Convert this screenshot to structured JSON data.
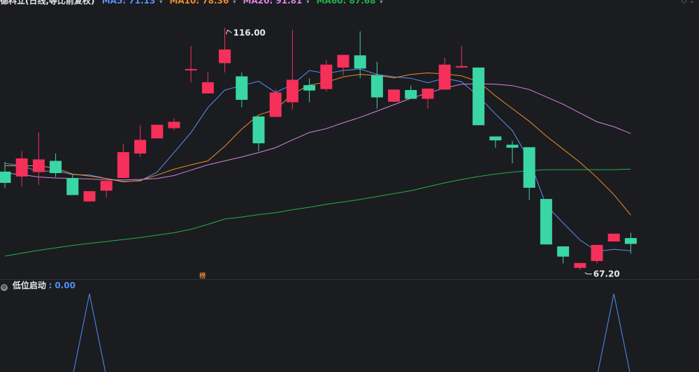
{
  "header": {
    "title": "德科立(日线,等比前复权)",
    "ma_items": [
      {
        "label": "MA5: 71.13",
        "color": "#5b8ff5"
      },
      {
        "label": "MA10: 78.36",
        "color": "#ef8d2b"
      },
      {
        "label": "MA20: 91.81",
        "color": "#d783e0"
      },
      {
        "label": "MA60: 87.68",
        "color": "#22b14c"
      }
    ],
    "arrow_glyph": "▾",
    "menu_icon": "chevron-diamond-icon"
  },
  "colors": {
    "background": "#1b1c20",
    "up": "#f5305a",
    "down": "#3ad6a4",
    "ma5": "#5b8ff5",
    "ma10": "#ef8d2b",
    "ma20": "#d783e0",
    "ma60": "#22b14c",
    "indicator": "#4f8ef7"
  },
  "annotations": {
    "high_label": "116.00",
    "low_label": "67.20",
    "bang_label": "榜"
  },
  "sub_panel": {
    "indicator_name": "低位启动",
    "separator": ":",
    "indicator_value": "0.00"
  },
  "chart_data": [
    {
      "type": "candlestick",
      "title": "德科立(日线,等比前复权)",
      "ylim": [
        66,
        121
      ],
      "high_point": 116.0,
      "low_point": 67.2,
      "candles": [
        {
          "o": 87.3,
          "c": 85.0,
          "h": 89.3,
          "l": 84.0
        },
        {
          "o": 86.3,
          "c": 90.0,
          "h": 91.5,
          "l": 84.3
        },
        {
          "o": 87.2,
          "c": 89.8,
          "h": 95.3,
          "l": 84.6
        },
        {
          "o": 89.5,
          "c": 87.0,
          "h": 91.0,
          "l": 86.2
        },
        {
          "o": 86.0,
          "c": 82.5,
          "h": 86.6,
          "l": 82.5
        },
        {
          "o": 81.2,
          "c": 83.3,
          "h": 83.3,
          "l": 81.2
        },
        {
          "o": 83.4,
          "c": 85.4,
          "h": 85.4,
          "l": 82.0
        },
        {
          "o": 86.0,
          "c": 91.3,
          "h": 93.0,
          "l": 86.0
        },
        {
          "o": 91.0,
          "c": 93.8,
          "h": 96.8,
          "l": 90.3
        },
        {
          "o": 94.1,
          "c": 96.9,
          "h": 96.9,
          "l": 94.1
        },
        {
          "o": 96.2,
          "c": 97.5,
          "h": 98.2,
          "l": 95.8
        },
        {
          "o": 108.1,
          "c": 108.3,
          "h": 113.0,
          "l": 105.6
        },
        {
          "o": 103.3,
          "c": 105.6,
          "h": 107.6,
          "l": 103.3
        },
        {
          "o": 109.5,
          "c": 112.3,
          "h": 116.8,
          "l": 107.6
        },
        {
          "o": 106.8,
          "c": 102.0,
          "h": 107.6,
          "l": 100.5
        },
        {
          "o": 98.6,
          "c": 93.1,
          "h": 98.6,
          "l": 91.5
        },
        {
          "o": 98.5,
          "c": 103.5,
          "h": 104.2,
          "l": 98.5
        },
        {
          "o": 101.5,
          "c": 106.1,
          "h": 116.3,
          "l": 100.0
        },
        {
          "o": 105.0,
          "c": 103.9,
          "h": 106.4,
          "l": 101.5
        },
        {
          "o": 104.2,
          "c": 109.2,
          "h": 110.1,
          "l": 103.7
        },
        {
          "o": 108.6,
          "c": 111.2,
          "h": 111.2,
          "l": 107.0
        },
        {
          "o": 111.1,
          "c": 108.4,
          "h": 116.0,
          "l": 106.4
        },
        {
          "o": 107.0,
          "c": 102.5,
          "h": 109.8,
          "l": 100.2
        },
        {
          "o": 101.6,
          "c": 104.1,
          "h": 104.1,
          "l": 101.6
        },
        {
          "o": 104.0,
          "c": 102.2,
          "h": 104.9,
          "l": 102.2
        },
        {
          "o": 102.2,
          "c": 104.3,
          "h": 104.3,
          "l": 100.2
        },
        {
          "o": 104.1,
          "c": 109.2,
          "h": 110.6,
          "l": 104.1
        },
        {
          "o": 108.8,
          "c": 108.9,
          "h": 113.0,
          "l": 108.5
        },
        {
          "o": 108.6,
          "c": 96.8,
          "h": 108.6,
          "l": 96.8
        },
        {
          "o": 94.5,
          "c": 93.7,
          "h": 94.5,
          "l": 92.2
        },
        {
          "o": 92.8,
          "c": 92.2,
          "h": 93.6,
          "l": 89.0
        },
        {
          "o": 92.3,
          "c": 84.0,
          "h": 92.3,
          "l": 81.5
        },
        {
          "o": 81.7,
          "c": 72.4,
          "h": 81.7,
          "l": 72.4
        },
        {
          "o": 72.0,
          "c": 69.9,
          "h": 72.0,
          "l": 68.5
        },
        {
          "o": 67.6,
          "c": 68.6,
          "h": 68.6,
          "l": 67.2
        },
        {
          "o": 69.0,
          "c": 72.3,
          "h": 72.3,
          "l": 68.5
        },
        {
          "o": 73.0,
          "c": 74.6,
          "h": 74.6,
          "l": 73.0
        },
        {
          "o": 73.7,
          "c": 72.5,
          "h": 74.8,
          "l": 70.5
        }
      ],
      "ma_series": [
        {
          "name": "MA5",
          "values": [
            89.0,
            88.5,
            87.3,
            87.5,
            86.7,
            86.6,
            85.9,
            85.3,
            85.4,
            87.2,
            91.2,
            95.3,
            100.4,
            104.0,
            104.9,
            105.8,
            103.5,
            105.1,
            108.0,
            107.4,
            108.0,
            108.3,
            107.2,
            106.7,
            106.4,
            105.5,
            106.4,
            105.7,
            102.7,
            99.1,
            95.7,
            89.7,
            80.4,
            76.8,
            73.3,
            71.0,
            71.4,
            71.1
          ]
        },
        {
          "name": "MA10",
          "values": [
            88.5,
            88.5,
            88.5,
            88.0,
            86.8,
            86.4,
            85.9,
            85.2,
            85.5,
            86.6,
            87.8,
            88.7,
            89.5,
            92.5,
            96.0,
            98.9,
            100.0,
            103.2,
            105.0,
            105.6,
            106.7,
            107.2,
            107.0,
            106.5,
            107.2,
            107.5,
            107.3,
            106.9,
            105.7,
            102.8,
            100.2,
            97.6,
            94.6,
            91.9,
            89.2,
            86.1,
            82.6,
            78.4
          ]
        },
        {
          "name": "MA20",
          "values": [
            87.0,
            86.7,
            86.2,
            86.0,
            85.9,
            85.8,
            85.6,
            85.6,
            85.7,
            85.9,
            86.5,
            87.6,
            88.7,
            89.5,
            90.3,
            91.2,
            92.2,
            93.8,
            95.3,
            96.1,
            97.3,
            98.4,
            99.7,
            101.0,
            102.3,
            103.4,
            104.4,
            105.2,
            105.3,
            105.2,
            104.9,
            104.1,
            102.6,
            101.1,
            99.3,
            97.5,
            96.5,
            95.1
          ]
        },
        {
          "name": "MA60",
          "values": [
            70.0,
            70.6,
            71.2,
            71.7,
            72.2,
            72.6,
            73.0,
            73.4,
            73.8,
            74.3,
            74.8,
            75.5,
            76.5,
            77.6,
            78.0,
            78.5,
            78.9,
            79.5,
            80.0,
            80.6,
            81.1,
            81.6,
            82.2,
            82.8,
            83.4,
            84.2,
            85.0,
            85.7,
            86.3,
            86.8,
            87.2,
            87.5,
            87.7,
            87.7,
            87.7,
            87.7,
            87.7,
            87.8
          ]
        }
      ]
    },
    {
      "type": "line",
      "title": "低位启动",
      "series": [
        {
          "name": "低位启动",
          "x": [
            0,
            4,
            5,
            6,
            10,
            31,
            35,
            36,
            37,
            38
          ],
          "values": [
            0,
            0,
            1,
            0,
            0,
            0,
            0,
            1,
            0,
            0
          ]
        }
      ]
    }
  ]
}
